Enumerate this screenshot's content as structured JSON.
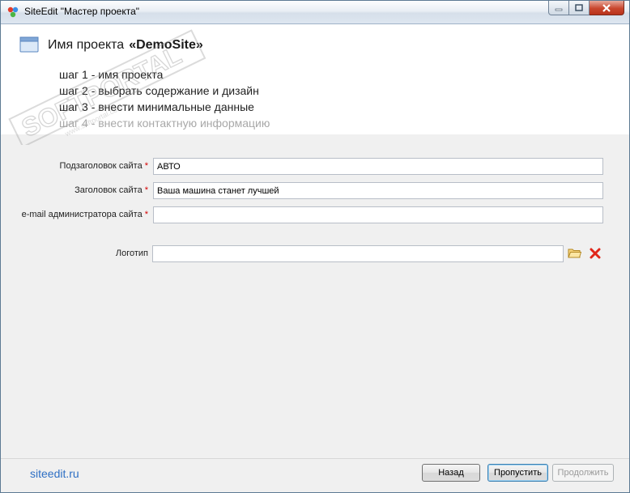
{
  "window": {
    "title": "SiteEdit \"Мастер проекта\""
  },
  "header": {
    "project_label": "Имя проекта",
    "project_name": "«DemoSite»",
    "steps": [
      {
        "label": "шаг 1 - имя проекта",
        "active": true
      },
      {
        "label": "шаг 2 - выбрать содержание и дизайн",
        "active": true
      },
      {
        "label": "шаг 3 - внести минимальные данные",
        "active": true
      },
      {
        "label": "шаг 4 - внести контактную информацию",
        "active": false
      }
    ]
  },
  "form": {
    "subtitle": {
      "label": "Подзаголовок сайта",
      "required_mark": "*",
      "value": "АВТО"
    },
    "title": {
      "label": "Заголовок сайта",
      "required_mark": "*",
      "value": "Ваша машина станет лучшей"
    },
    "email": {
      "label": "e-mail администратора сайта",
      "required_mark": "*",
      "value": ""
    },
    "logo": {
      "label": "Логотип",
      "value": ""
    }
  },
  "footer": {
    "site_link": "siteedit.ru",
    "back_label": "Назад",
    "skip_label": "Пропустить",
    "next_label": "Продолжить"
  },
  "icons": {
    "app": "app-icon",
    "project": "window-icon",
    "browse": "folder-icon",
    "delete": "delete-icon"
  },
  "colors": {
    "required": "#d40000",
    "link": "#2e6fc4",
    "delete": "#e0261a"
  }
}
